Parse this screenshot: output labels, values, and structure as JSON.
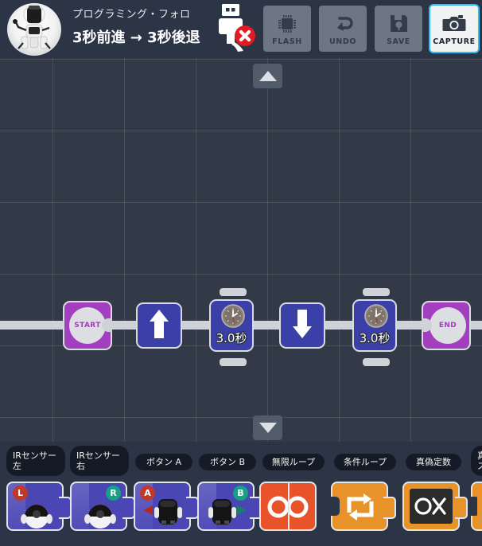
{
  "header": {
    "subtitle": "プログラミング・フォロ",
    "title": "3秒前進 → 3秒後退",
    "avatar_icon": "robot-avatar-icon",
    "usb_status_icon": "usb-disconnected-icon",
    "background_color": "#2b3545"
  },
  "toolbar": {
    "buttons": [
      {
        "id": "flash",
        "label": "FLASH",
        "icon": "chip-icon",
        "active": false
      },
      {
        "id": "undo",
        "label": "UNDO",
        "icon": "undo-arrow-icon",
        "active": false
      },
      {
        "id": "save",
        "label": "SAVE",
        "icon": "floppy-disk-icon",
        "active": false
      },
      {
        "id": "capture",
        "label": "CAPTURE",
        "icon": "camera-icon",
        "active": true
      }
    ],
    "active_highlight_color": "#2fbdf0"
  },
  "canvas": {
    "background_color": "#323a47",
    "grid_size": 90,
    "scroll_up_icon": "triangle-up-icon",
    "scroll_down_icon": "triangle-down-icon",
    "program": [
      {
        "id": "start",
        "type": "terminal",
        "label": "START",
        "color": "#a23fbe"
      },
      {
        "id": "forward",
        "type": "move",
        "icon": "arrow-up-icon",
        "color": "#3b3fa8"
      },
      {
        "id": "timer1",
        "type": "timer",
        "icon": "clock-icon",
        "value": "3.0秒",
        "color": "#3b3fa8"
      },
      {
        "id": "backward",
        "type": "move",
        "icon": "arrow-down-icon",
        "color": "#3b3fa8"
      },
      {
        "id": "timer2",
        "type": "timer",
        "icon": "clock-icon",
        "value": "3.0秒",
        "color": "#3b3fa8"
      },
      {
        "id": "end",
        "type": "terminal",
        "label": "END",
        "color": "#a23fbe"
      }
    ]
  },
  "palette": {
    "background_color": "#2b3545",
    "items": [
      {
        "id": "ir-left",
        "label": "IRセンサー\n左",
        "label_line1": "IRセンサー",
        "label_line2": "左",
        "badge": "L",
        "badge_color": "#c0392b",
        "icon": "robot-head-icon",
        "color": "#4a47b5"
      },
      {
        "id": "ir-right",
        "label": "IRセンサー\n右",
        "label_line1": "IRセンサー",
        "label_line2": "右",
        "badge": "R",
        "badge_color": "#16a085",
        "icon": "robot-head-icon",
        "color": "#4a47b5"
      },
      {
        "id": "button-a",
        "label": "ボタン A",
        "badge": "A",
        "badge_color": "#c0392b",
        "icon": "robot-body-icon",
        "color": "#4a47b5"
      },
      {
        "id": "button-b",
        "label": "ボタン B",
        "badge": "B",
        "badge_color": "#16a085",
        "icon": "robot-body-icon",
        "color": "#4a47b5"
      },
      {
        "id": "infinite-loop",
        "label": "無限ループ",
        "icon": "infinity-icon",
        "color": "#e8532a"
      },
      {
        "id": "conditional-loop",
        "label": "条件ループ",
        "icon": "loop-arrows-icon",
        "color": "#e8932a"
      },
      {
        "id": "boolean-constant",
        "label": "真偽定数",
        "icon": "circle-cross-icon",
        "color": "#e8932a"
      },
      {
        "id": "truth-partial",
        "label": "真",
        "label_line1": "真",
        "label_line2": "ス",
        "icon": "partial-block-icon",
        "color": "#e8932a"
      }
    ]
  }
}
